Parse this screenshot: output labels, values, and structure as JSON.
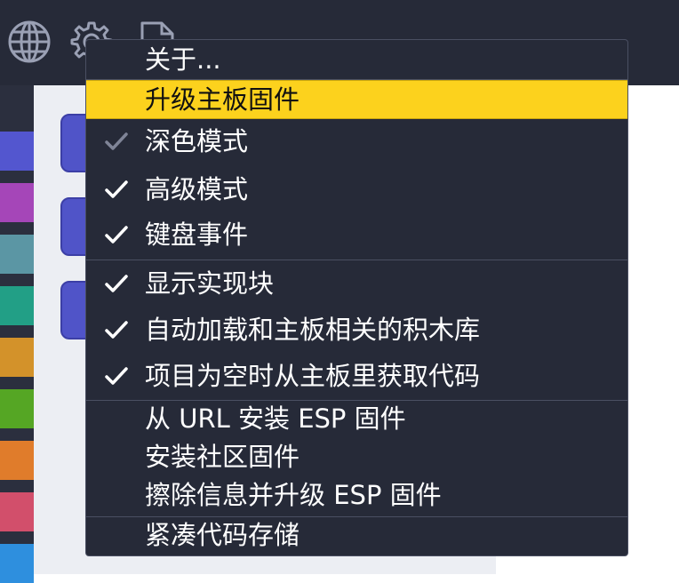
{
  "toolbar": {
    "icons": [
      "globe-icon",
      "gear-icon",
      "file-icon"
    ]
  },
  "categories": {
    "colors": [
      "#5356cf",
      "#a546b8",
      "#5b96a4",
      "#229f86",
      "#d3922a",
      "#55a624",
      "#e07c2b",
      "#d24f6b",
      "#2e8fde"
    ]
  },
  "menu": {
    "items": [
      {
        "label": "关于...",
        "checked": false
      },
      {
        "label": "升级主板固件",
        "checked": false,
        "highlighted": true
      },
      {
        "label": "深色模式",
        "checked": true,
        "dimmed_check": true
      },
      {
        "label": "高级模式",
        "checked": true
      },
      {
        "label": "键盘事件",
        "checked": true
      },
      {
        "label": "显示实现块",
        "checked": true
      },
      {
        "label": "自动加载和主板相关的积木库",
        "checked": true
      },
      {
        "label": "项目为空时从主板里获取代码",
        "checked": true
      },
      {
        "label": "从 URL 安装 ESP 固件",
        "checked": false
      },
      {
        "label": "安装社区固件",
        "checked": false
      },
      {
        "label": "擦除信息并升级 ESP 固件",
        "checked": false
      },
      {
        "label": "紧凑代码存储",
        "checked": false
      }
    ]
  },
  "colors": {
    "highlight": "#fcd21d",
    "menu_bg": "#262a38",
    "check": "#ffffff",
    "check_dimmed": "#7f8497"
  }
}
